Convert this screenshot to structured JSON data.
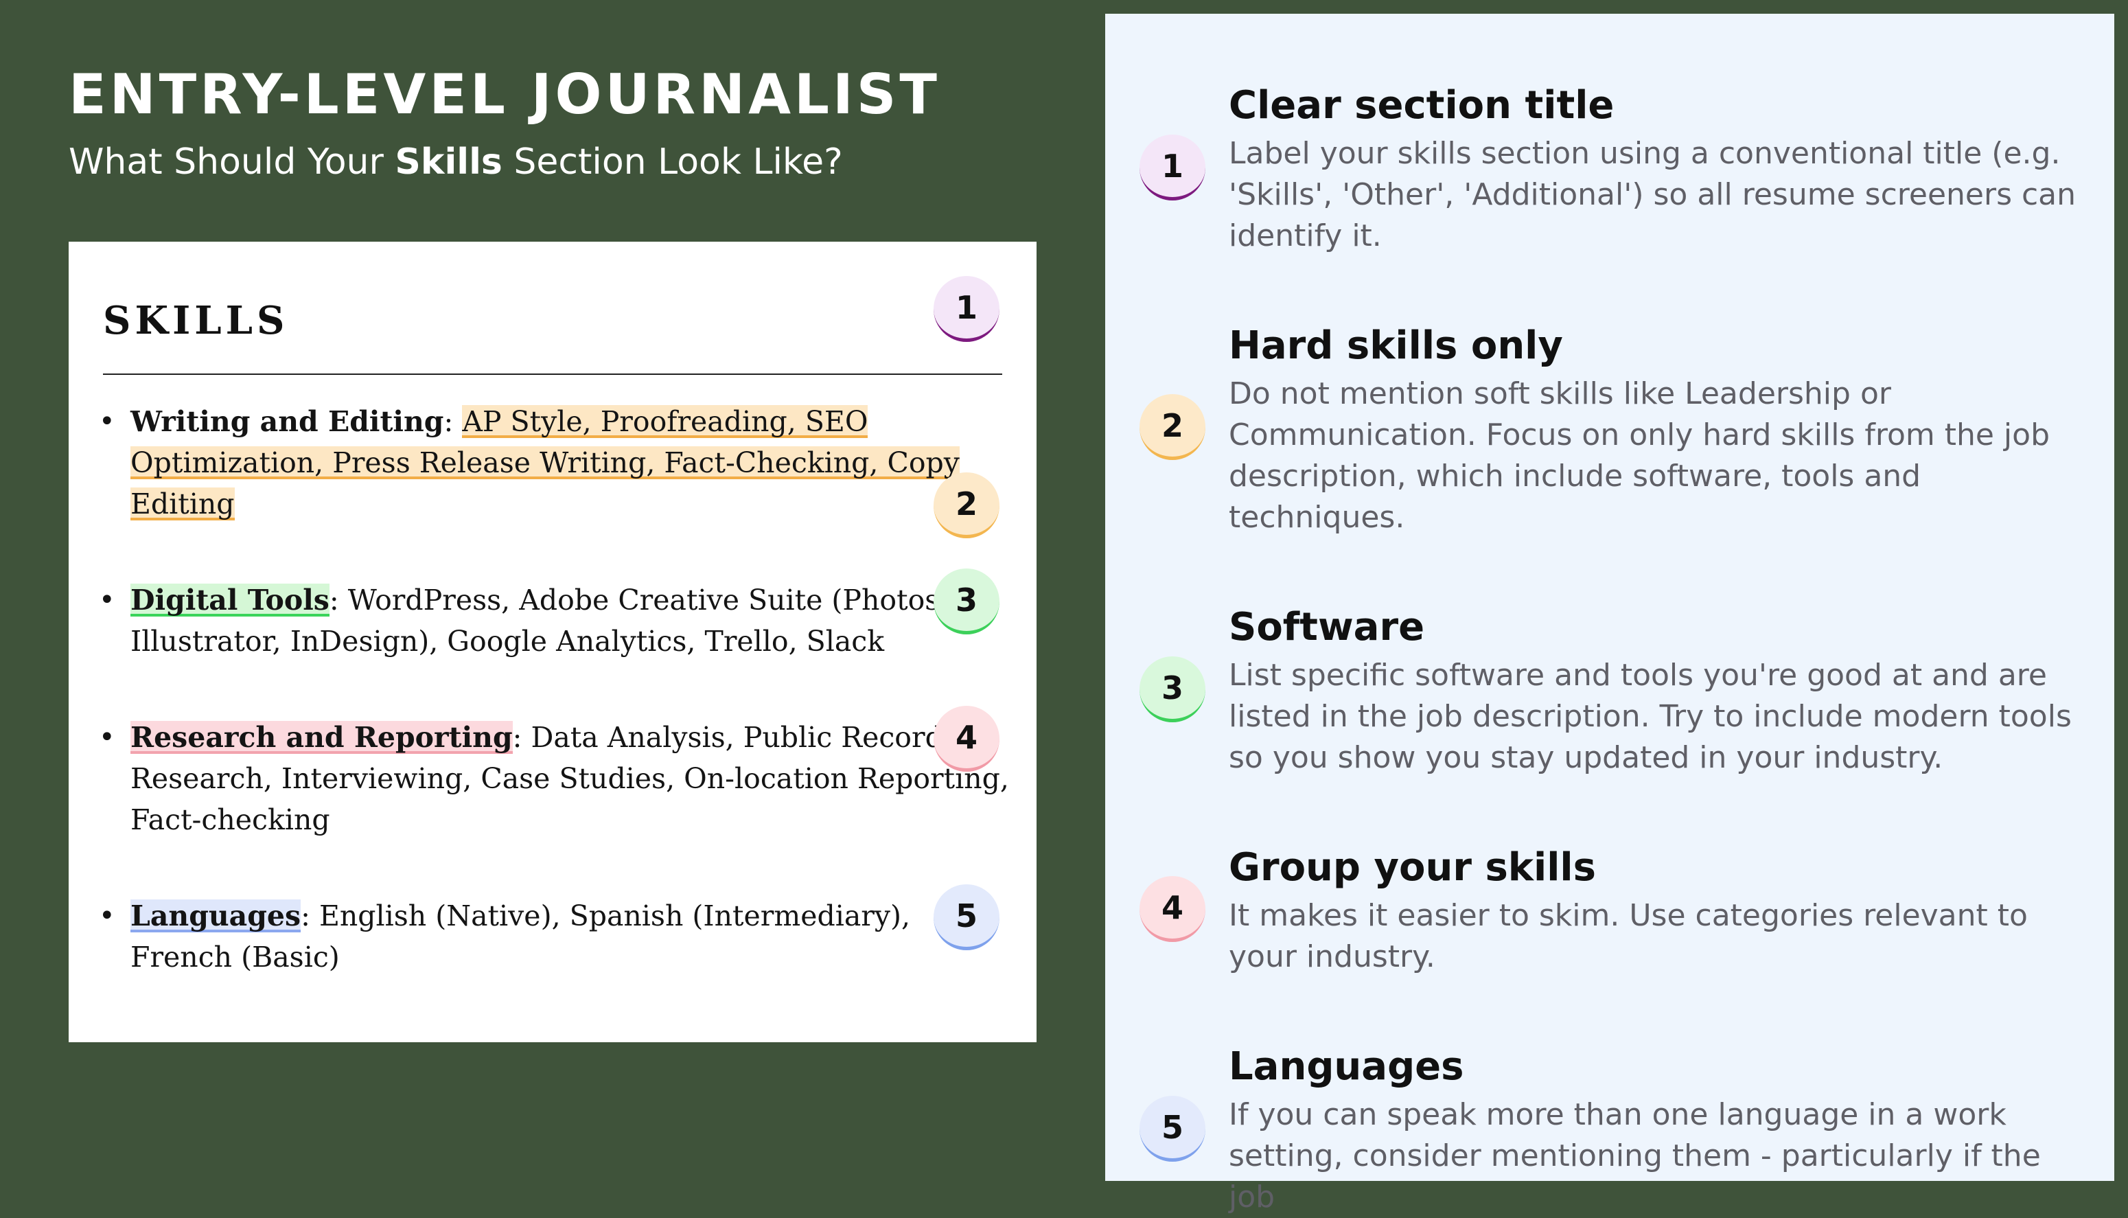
{
  "header": {
    "title": "ENTRY-LEVEL JOURNALIST",
    "subtitle_before": "What Should Your ",
    "subtitle_bold": "Skills",
    "subtitle_after": " Section Look Like?"
  },
  "resume": {
    "heading": "SKILLS",
    "skills": [
      {
        "category": "Writing and Editing",
        "items": "AP Style, Proofreading, SEO Optimization, Press Release Writing, Fact-Checking, Copy Editing"
      },
      {
        "category": "Digital Tools",
        "items": "WordPress, Adobe Creative Suite (Photoshop, Illustrator, InDesign), Google Analytics, Trello, Slack"
      },
      {
        "category": "Research and Reporting",
        "items": "Data Analysis, Public Records Research, Interviewing, Case Studies, On-location Reporting, Fact-checking"
      },
      {
        "category": "Languages",
        "items": "English (Native), Spanish (Intermediary), French (Basic)"
      }
    ],
    "separator": ": ",
    "badges": [
      "1",
      "2",
      "3",
      "4",
      "5"
    ]
  },
  "tips": [
    {
      "number": "1",
      "title": "Clear section title",
      "body": "Label your skills section using a conventional title (e.g. 'Skills', 'Other', 'Additional') so all resume screeners can identify it."
    },
    {
      "number": "2",
      "title": "Hard skills only",
      "body": "Do not mention soft skills like Leadership or Communication. Focus on only hard skills from the job description, which include software, tools and techniques."
    },
    {
      "number": "3",
      "title": "Software",
      "body": "List specific software and tools you're good at and are listed in the job description. Try to include modern tools so you show you stay updated in your industry."
    },
    {
      "number": "4",
      "title": "Group your skills",
      "body": "It makes it easier to skim. Use categories relevant to your industry."
    },
    {
      "number": "5",
      "title": "Languages",
      "body": "If you can speak more than one language in a work setting, consider mentioning them - particularly if the job"
    }
  ],
  "colors": {
    "background": "#3f533a",
    "panel": "#eef5fd",
    "badge1_accent": "#7d1a7f",
    "badge2_accent": "#f3b64f",
    "badge3_accent": "#3cd05a",
    "badge4_accent": "#f19aa6",
    "badge5_accent": "#7ea1ec"
  }
}
